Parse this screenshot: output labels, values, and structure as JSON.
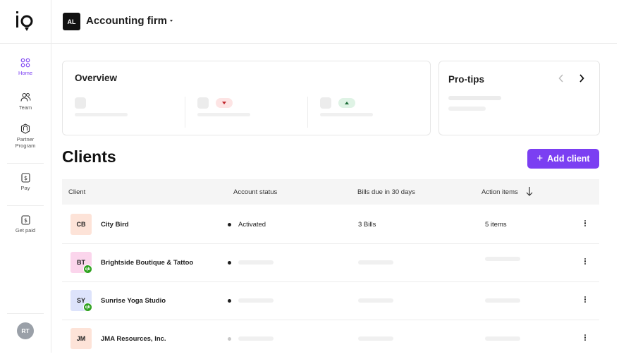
{
  "app": {
    "logo": "io"
  },
  "sidebar": {
    "items": [
      {
        "label": "Home",
        "icon": "home-grid-icon",
        "active": true
      },
      {
        "label": "Team",
        "icon": "team-icon",
        "active": false
      },
      {
        "label": "Partner\nProgram",
        "icon": "partner-program-icon",
        "active": false
      },
      {
        "label": "Pay",
        "icon": "pay-icon",
        "active": false
      },
      {
        "label": "Get paid",
        "icon": "get-paid-icon",
        "active": false
      }
    ],
    "user_initials": "RT"
  },
  "header": {
    "firm_initials": "AL",
    "firm_name": "Accounting firm"
  },
  "overview": {
    "title": "Overview"
  },
  "protips": {
    "title": "Pro-tips",
    "prev_icon": "chevron-left-icon",
    "next_icon": "chevron-right-icon"
  },
  "clients": {
    "title": "Clients",
    "add_button": "Add client",
    "columns": [
      "Client",
      "Account status",
      "Bills due in 30 days",
      "Action items"
    ],
    "sort_icon": "arrow-down-icon",
    "rows": [
      {
        "initials": "CB",
        "name": "City Bird",
        "status": "Activated",
        "bills": "3 Bills",
        "actions": "5 items",
        "avatar_color": "#fde3d8",
        "quickbooks": false,
        "loaded": true
      },
      {
        "initials": "BT",
        "name": "Brightside Boutique & Tattoo",
        "status": "",
        "bills": "",
        "actions": "",
        "avatar_color": "#fbd5ec",
        "quickbooks": true,
        "loaded": false
      },
      {
        "initials": "SY",
        "name": "Sunrise Yoga Studio",
        "status": "",
        "bills": "",
        "actions": "",
        "avatar_color": "#dde3fb",
        "quickbooks": true,
        "loaded": false
      },
      {
        "initials": "JM",
        "name": "JMA Resources, Inc.",
        "status": "",
        "bills": "",
        "actions": "",
        "avatar_color": "#fde3d8",
        "quickbooks": false,
        "loaded": false
      }
    ],
    "quickbooks_badge": "qb"
  },
  "colors": {
    "accent": "#7b3ff2",
    "quickbooks": "#2ca01c"
  }
}
